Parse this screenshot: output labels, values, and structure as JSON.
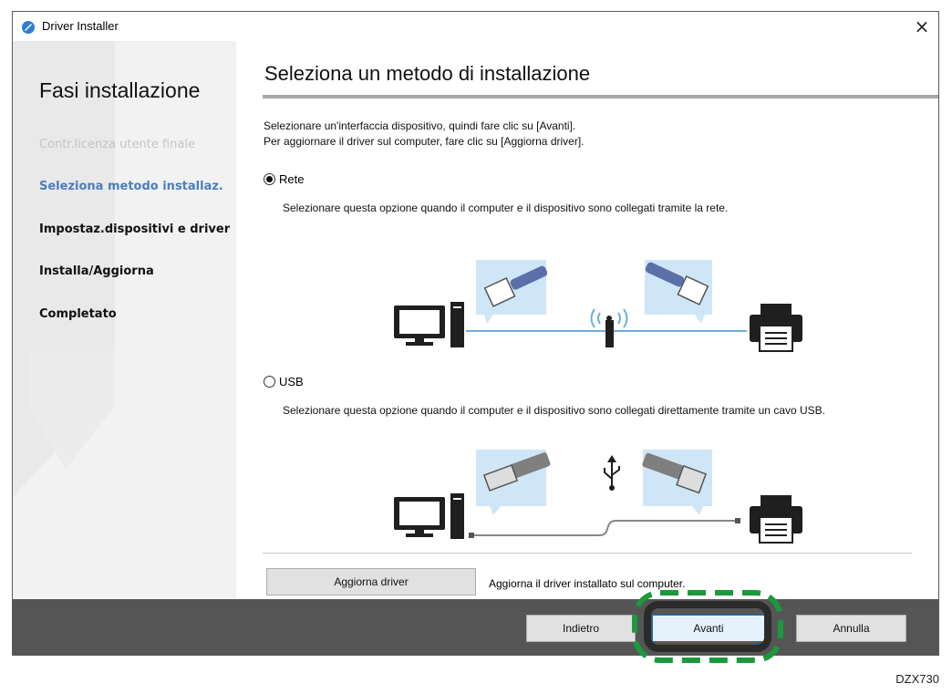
{
  "window": {
    "title": "Driver Installer",
    "close_glyph": "×"
  },
  "sidebar": {
    "title": "Fasi installazione",
    "steps": [
      {
        "label": "Contr.licenza utente finale",
        "state": "done"
      },
      {
        "label": "Seleziona metodo installaz.",
        "state": "current"
      },
      {
        "label": "Impostaz.dispositivi e driver",
        "state": "todo"
      },
      {
        "label": "Installa/Aggiorna",
        "state": "todo"
      },
      {
        "label": "Completato",
        "state": "todo"
      }
    ]
  },
  "main": {
    "heading": "Seleziona un metodo di installazione",
    "instructions": [
      "Selezionare un'interfaccia dispositivo, quindi fare clic su [Avanti].",
      "Per aggiornare il driver sul computer, fare clic su [Aggiorna driver]."
    ],
    "options": [
      {
        "label": "Rete",
        "checked": true,
        "description": "Selezionare questa opzione quando il computer e il dispositivo sono collegati tramite la rete."
      },
      {
        "label": "USB",
        "checked": false,
        "description": "Selezionare questa opzione quando il computer e il dispositivo sono collegati direttamente tramite un cavo USB."
      }
    ],
    "update_button": "Aggiorna driver",
    "update_description": "Aggiorna il driver installato sul computer."
  },
  "footer": {
    "back": "Indietro",
    "next": "Avanti",
    "cancel": "Annulla"
  },
  "colors": {
    "accent": "#4a7ec0",
    "highlight": "#1a9a3c",
    "footer": "#555556",
    "bubble": "#cfe6f6",
    "cable": "#5b6fa8"
  },
  "caption": "DZX730"
}
